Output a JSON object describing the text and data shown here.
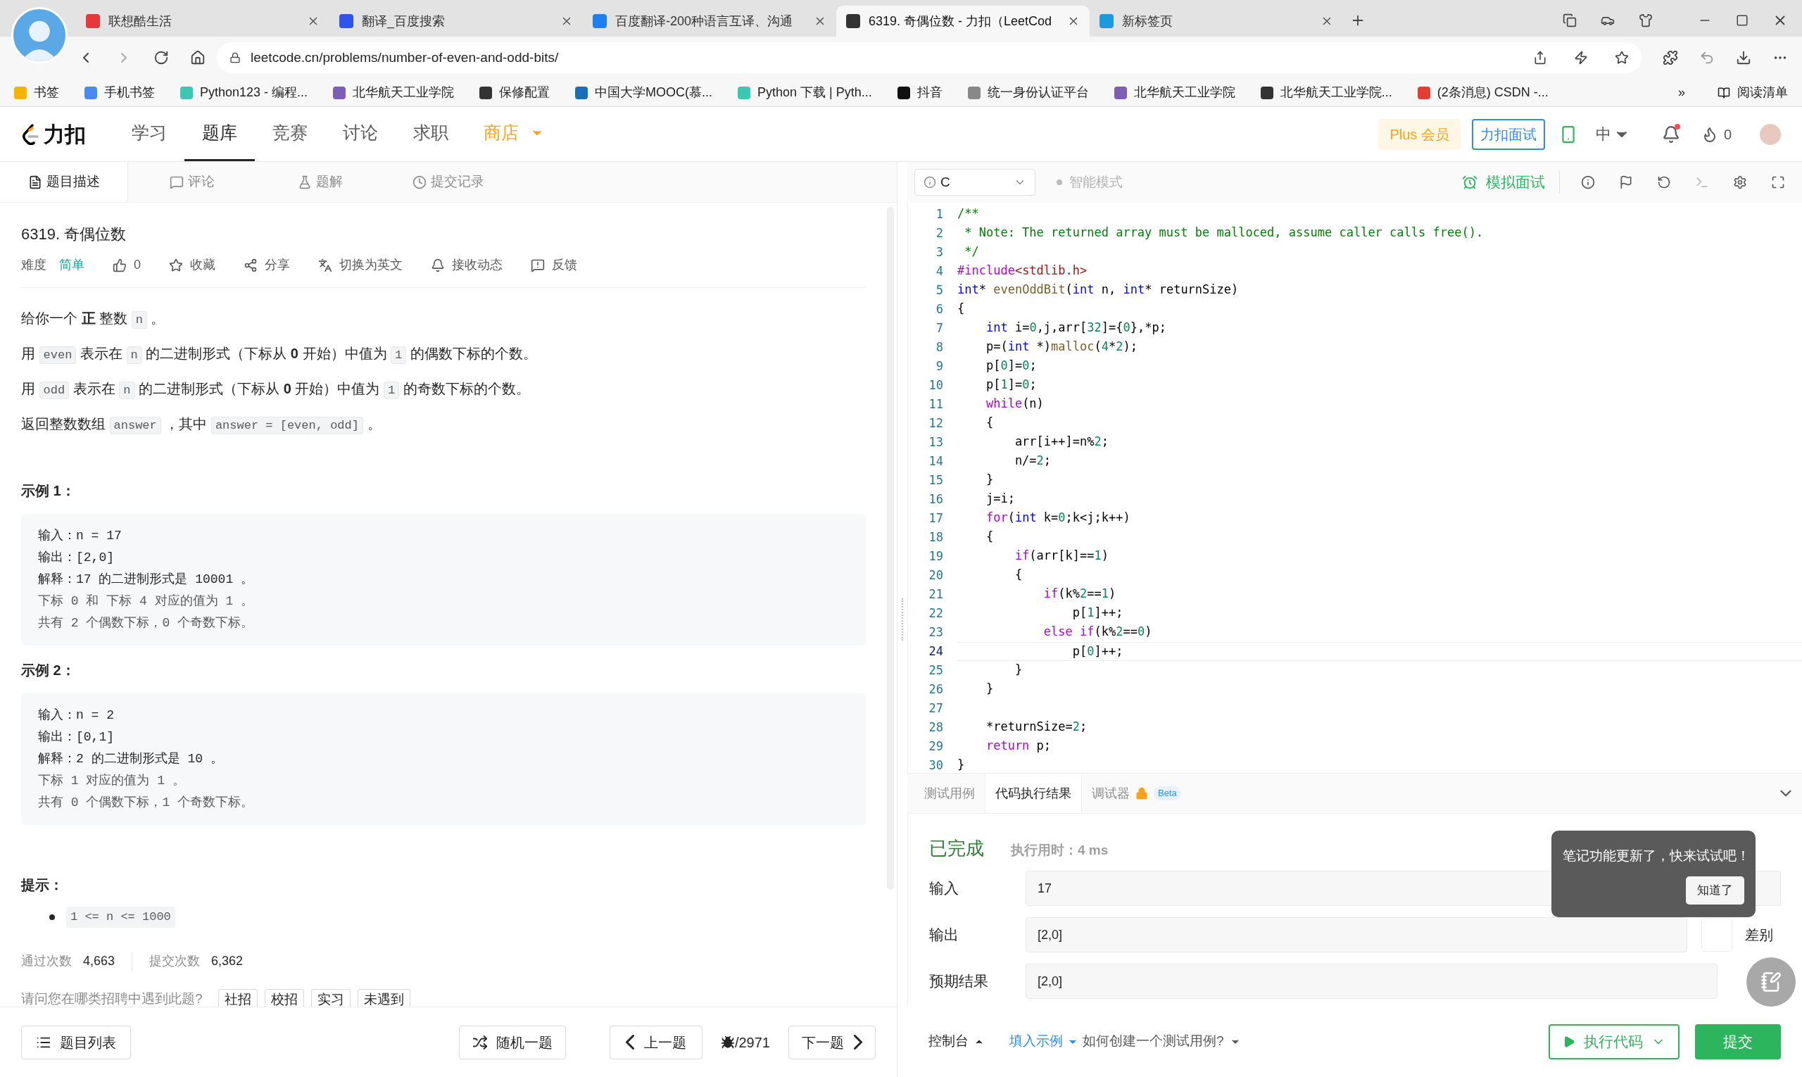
{
  "browser": {
    "tabs": [
      {
        "title": "联想酷生活",
        "selected": false,
        "color": "#e8363c"
      },
      {
        "title": "翻译_百度搜索",
        "selected": false,
        "color": "#2f54eb"
      },
      {
        "title": "百度翻译-200种语言互译、沟通",
        "selected": false,
        "color": "#1e7ff0"
      },
      {
        "title": "6319. 奇偶位数 - 力扣（LeetCod",
        "selected": true,
        "color": "#333333"
      },
      {
        "title": "新标签页",
        "selected": false,
        "color": "#1b9ae0"
      }
    ],
    "url": "leetcode.cn/problems/number-of-even-and-odd-bits/",
    "bookmarks": [
      {
        "label": "书签",
        "color": "#f4b400"
      },
      {
        "label": "手机书签",
        "color": "#4a8af4"
      },
      {
        "label": "Python123 - 编程...",
        "color": "#3cc7b3"
      },
      {
        "label": "北华航天工业学院",
        "color": "#7a5fb5"
      },
      {
        "label": "保修配置",
        "color": "#333333"
      },
      {
        "label": "中国大学MOOC(慕...",
        "color": "#1b6fb8"
      },
      {
        "label": "Python 下载 | Pyth...",
        "color": "#3cc7b3"
      },
      {
        "label": "抖音",
        "color": "#111111"
      },
      {
        "label": "统一身份认证平台",
        "color": "#888888"
      },
      {
        "label": "北华航天工业学院",
        "color": "#7a5fb5"
      },
      {
        "label": "北华航天工业学院...",
        "color": "#333333"
      },
      {
        "label": "(2条消息) CSDN -...",
        "color": "#e33e33"
      }
    ],
    "more": "»",
    "reading_list": "阅读清单"
  },
  "site_nav": {
    "logo": "力扣",
    "items": [
      {
        "label": "学习",
        "selected": false,
        "highlight": false
      },
      {
        "label": "题库",
        "selected": true,
        "highlight": false
      },
      {
        "label": "竞赛",
        "selected": false,
        "highlight": false
      },
      {
        "label": "讨论",
        "selected": false,
        "highlight": false
      },
      {
        "label": "求职",
        "selected": false,
        "highlight": false
      },
      {
        "label": "商店",
        "selected": false,
        "highlight": true
      }
    ],
    "plus": "Plus 会员",
    "interview": "力扣面试",
    "language": "中",
    "unread": true,
    "points": "0"
  },
  "problem_tabs": [
    {
      "label": "题目描述",
      "selected": true
    },
    {
      "label": "评论",
      "selected": false
    },
    {
      "label": "题解",
      "selected": false
    },
    {
      "label": "提交记录",
      "selected": false
    }
  ],
  "problem": {
    "title": "6319. 奇偶位数",
    "difficulty_label": "难度",
    "difficulty": "简单",
    "likes": "0",
    "actions": [
      {
        "label": "收藏",
        "kind": "star"
      },
      {
        "label": "分享",
        "kind": "share"
      },
      {
        "label": "切换为英文",
        "kind": "translate"
      },
      {
        "label": "接收动态",
        "kind": "bell"
      },
      {
        "label": "反馈",
        "kind": "feedback"
      }
    ],
    "paragraphs": [
      [
        {
          "text": "给你一个 **正** 整数 "
        },
        {
          "code": "n"
        },
        {
          "text": " 。"
        }
      ],
      [
        {
          "text": "用 "
        },
        {
          "code": "even"
        },
        {
          "text": " 表示在 "
        },
        {
          "code": "n"
        },
        {
          "text": " 的二进制形式（下标从 **0** 开始）中值为 "
        },
        {
          "code": "1"
        },
        {
          "text": " 的偶数下标的个数。"
        }
      ],
      [
        {
          "text": "用 "
        },
        {
          "code": "odd"
        },
        {
          "text": " 表示在 "
        },
        {
          "code": "n"
        },
        {
          "text": " 的二进制形式（下标从 **0** 开始）中值为 "
        },
        {
          "code": "1"
        },
        {
          "text": " 的奇数下标的个数。"
        }
      ],
      [
        {
          "text": "返回整数数组 "
        },
        {
          "code": "answer"
        },
        {
          "text": " ，其中 "
        },
        {
          "code": "answer = [even, odd]"
        },
        {
          "text": " 。"
        }
      ]
    ],
    "examples": [
      {
        "title": "示例 1：",
        "lines": [
          {
            "text": "输入：n = 17",
            "kind": "main"
          },
          {
            "text": "输出：[2,0]",
            "kind": "main"
          },
          {
            "text": "解释：17 的二进制形式是 10001 。",
            "kind": "main"
          },
          {
            "text": "下标 0 和 下标 4 对应的值为 1 。",
            "kind": "note"
          },
          {
            "text": "共有 2 个偶数下标，0 个奇数下标。",
            "kind": "note"
          }
        ]
      },
      {
        "title": "示例 2：",
        "lines": [
          {
            "text": "输入：n = 2",
            "kind": "main"
          },
          {
            "text": "输出：[0,1]",
            "kind": "main"
          },
          {
            "text": "解释：2 的二进制形式是 10 。",
            "kind": "main"
          },
          {
            "text": "下标 1 对应的值为 1 。",
            "kind": "note"
          },
          {
            "text": "共有 0 个偶数下标，1 个奇数下标。",
            "kind": "note"
          }
        ]
      }
    ],
    "hints_title": "提示：",
    "hints": [
      "1 <= n <= 1000"
    ],
    "stats": [
      {
        "label": "通过次数",
        "value": "4,663"
      },
      {
        "label": "提交次数",
        "value": "6,362"
      }
    ],
    "survey": {
      "question": "请问您在哪类招聘中遇到此题?",
      "options": [
        "社招",
        "校招",
        "实习",
        "未遇到"
      ]
    }
  },
  "problem_footer": {
    "list": "题目列表",
    "random": "随机一题",
    "prev": "上一题",
    "counter": "/2971",
    "next": "下一题"
  },
  "editor": {
    "language": "C",
    "smart_mode": "智能模式",
    "mock_interview": "模拟面试",
    "lines": [
      {
        "number": "1",
        "current": false,
        "tokens": [
          {
            "text": "/**",
            "kind": "comment"
          }
        ]
      },
      {
        "number": "2",
        "current": false,
        "tokens": [
          {
            "text": " * Note: The returned array must be malloced, assume caller calls free().",
            "kind": "comment"
          }
        ]
      },
      {
        "number": "3",
        "current": false,
        "tokens": [
          {
            "text": " */",
            "kind": "comment"
          }
        ]
      },
      {
        "number": "4",
        "current": false,
        "tokens": [
          {
            "text": "#include",
            "kind": "control"
          },
          {
            "text": "<stdlib.h>",
            "kind": "string"
          }
        ]
      },
      {
        "number": "5",
        "current": false,
        "tokens": [
          {
            "text": "int",
            "kind": "type"
          },
          {
            "text": "* "
          },
          {
            "text": "evenOddBit",
            "kind": "function"
          },
          {
            "text": "("
          },
          {
            "text": "int",
            "kind": "type"
          },
          {
            "text": " n, "
          },
          {
            "text": "int",
            "kind": "type"
          },
          {
            "text": "* returnSize)"
          }
        ]
      },
      {
        "number": "6",
        "current": false,
        "tokens": [
          {
            "text": "{"
          }
        ]
      },
      {
        "number": "7",
        "current": false,
        "tokens": [
          {
            "text": "    int",
            "kind": "type"
          },
          {
            "text": " i="
          },
          {
            "text": "0",
            "kind": "number"
          },
          {
            "text": ",j,arr["
          },
          {
            "text": "32",
            "kind": "number"
          },
          {
            "text": "]={"
          },
          {
            "text": "0",
            "kind": "number"
          },
          {
            "text": "},*p;"
          }
        ]
      },
      {
        "number": "8",
        "current": false,
        "tokens": [
          {
            "text": "    p=("
          },
          {
            "text": "int",
            "kind": "type"
          },
          {
            "text": " *)"
          },
          {
            "text": "malloc",
            "kind": "function"
          },
          {
            "text": "("
          },
          {
            "text": "4",
            "kind": "number"
          },
          {
            "text": "*"
          },
          {
            "text": "2",
            "kind": "number"
          },
          {
            "text": ");"
          }
        ]
      },
      {
        "number": "9",
        "current": false,
        "tokens": [
          {
            "text": "    p["
          },
          {
            "text": "0",
            "kind": "number"
          },
          {
            "text": "]="
          },
          {
            "text": "0",
            "kind": "number"
          },
          {
            "text": ";"
          }
        ]
      },
      {
        "number": "10",
        "current": false,
        "tokens": [
          {
            "text": "    p["
          },
          {
            "text": "1",
            "kind": "number"
          },
          {
            "text": "]="
          },
          {
            "text": "0",
            "kind": "number"
          },
          {
            "text": ";"
          }
        ]
      },
      {
        "number": "11",
        "current": false,
        "tokens": [
          {
            "text": "    while",
            "kind": "control"
          },
          {
            "text": "(n)"
          }
        ]
      },
      {
        "number": "12",
        "current": false,
        "tokens": [
          {
            "text": "    {"
          }
        ]
      },
      {
        "number": "13",
        "current": false,
        "tokens": [
          {
            "text": "        arr[i++]=n%"
          },
          {
            "text": "2",
            "kind": "number"
          },
          {
            "text": ";"
          }
        ]
      },
      {
        "number": "14",
        "current": false,
        "tokens": [
          {
            "text": "        n/="
          },
          {
            "text": "2",
            "kind": "number"
          },
          {
            "text": ";"
          }
        ]
      },
      {
        "number": "15",
        "current": false,
        "tokens": [
          {
            "text": "    }"
          }
        ]
      },
      {
        "number": "16",
        "current": false,
        "tokens": [
          {
            "text": "    j=i;"
          }
        ]
      },
      {
        "number": "17",
        "current": false,
        "tokens": [
          {
            "text": "    for",
            "kind": "control"
          },
          {
            "text": "("
          },
          {
            "text": "int",
            "kind": "type"
          },
          {
            "text": " k="
          },
          {
            "text": "0",
            "kind": "number"
          },
          {
            "text": ";k<j;k++)"
          }
        ]
      },
      {
        "number": "18",
        "current": false,
        "tokens": [
          {
            "text": "    {"
          }
        ]
      },
      {
        "number": "19",
        "current": false,
        "tokens": [
          {
            "text": "        if",
            "kind": "control"
          },
          {
            "text": "(arr[k]=="
          },
          {
            "text": "1",
            "kind": "number"
          },
          {
            "text": ")"
          }
        ]
      },
      {
        "number": "20",
        "current": false,
        "tokens": [
          {
            "text": "        {"
          }
        ]
      },
      {
        "number": "21",
        "current": false,
        "tokens": [
          {
            "text": "            if",
            "kind": "control"
          },
          {
            "text": "(k%"
          },
          {
            "text": "2",
            "kind": "number"
          },
          {
            "text": "=="
          },
          {
            "text": "1",
            "kind": "number"
          },
          {
            "text": ")"
          }
        ]
      },
      {
        "number": "22",
        "current": false,
        "tokens": [
          {
            "text": "                p["
          },
          {
            "text": "1",
            "kind": "number"
          },
          {
            "text": "]++;"
          }
        ]
      },
      {
        "number": "23",
        "current": false,
        "tokens": [
          {
            "text": "            else",
            "kind": "control"
          },
          {
            "text": " if",
            "kind": "control"
          },
          {
            "text": "(k%"
          },
          {
            "text": "2",
            "kind": "number"
          },
          {
            "text": "=="
          },
          {
            "text": "0",
            "kind": "number"
          },
          {
            "text": ")"
          }
        ]
      },
      {
        "number": "24",
        "current": true,
        "tokens": [
          {
            "text": "                p["
          },
          {
            "text": "0",
            "kind": "number"
          },
          {
            "text": "]++;"
          }
        ]
      },
      {
        "number": "25",
        "current": false,
        "tokens": [
          {
            "text": "        }"
          }
        ]
      },
      {
        "number": "26",
        "current": false,
        "tokens": [
          {
            "text": "    }"
          }
        ]
      },
      {
        "number": "27",
        "current": false
      },
      {
        "number": "28",
        "current": false,
        "tokens": [
          {
            "text": "    *returnSize="
          },
          {
            "text": "2",
            "kind": "number"
          },
          {
            "text": ";"
          }
        ]
      },
      {
        "number": "29",
        "current": false,
        "tokens": [
          {
            "text": "    return",
            "kind": "control"
          },
          {
            "text": " p;"
          }
        ]
      },
      {
        "number": "30",
        "current": false,
        "tokens": [
          {
            "text": "}"
          }
        ]
      }
    ]
  },
  "console": {
    "tabs": [
      {
        "label": "测试用例",
        "selected": false,
        "locked": false
      },
      {
        "label": "代码执行结果",
        "selected": true,
        "locked": false
      },
      {
        "label": "调试器",
        "selected": false,
        "locked": true,
        "badge": "Beta"
      }
    ],
    "status": "已完成",
    "runtime": "执行用时：4 ms",
    "rows": [
      {
        "label": "输入",
        "value": "17"
      },
      {
        "label": "输出",
        "value": "[2,0]"
      },
      {
        "label": "预期结果",
        "value": "[2,0]"
      }
    ],
    "diff": "差别",
    "popup": {
      "message": "笔记功能更新了，快来试试吧！",
      "button": "知道了"
    },
    "footer": {
      "console": "控制台",
      "fill": "填入示例",
      "how": "如何创建一个测试用例?",
      "run": "执行代码",
      "submit": "提交"
    }
  }
}
